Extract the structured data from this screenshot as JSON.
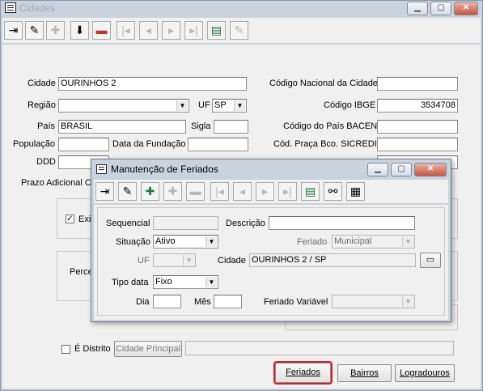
{
  "main_window": {
    "title": "Cidades",
    "fields": {
      "cidade_label": "Cidade",
      "cidade_value": "OURINHOS 2",
      "regiao_label": "Região",
      "regiao_value": "",
      "uf_label": "UF",
      "uf_value": "SP",
      "pais_label": "País",
      "pais_value": "BRASIL",
      "sigla_label": "Sigla",
      "sigla_value": "",
      "populacao_label": "População",
      "populacao_value": "",
      "data_fundacao_label": "Data da Fundação",
      "data_fundacao_value": "",
      "ddd_label": "DDD",
      "ddd_value": "",
      "prazo_label": "Prazo Adicional Co",
      "codigo_nacional_label": "Código Nacional da Cidade",
      "codigo_nacional_value": "",
      "codigo_ibge_label": "Código IBGE",
      "codigo_ibge_value": "3534708",
      "codigo_pais_bacen_label": "Código do País BACEN",
      "codigo_pais_bacen_value": "",
      "cod_praca_label": "Cód. Praça Bco. SICREDI",
      "cod_praca_value": ""
    },
    "partial": {
      "exi_label": "Exi",
      "perce_label": "Perce"
    },
    "distrito_label": "É Distrito",
    "cidade_principal_button": "Cidade Principal",
    "cidade_principal_value": "",
    "buttons": {
      "feriados": "Feriados",
      "bairros": "Bairros",
      "logradouros": "Logradouros"
    }
  },
  "modal": {
    "title": "Manutenção de Feriados",
    "sequencial_label": "Sequencial",
    "sequencial_value": "",
    "descricao_label": "Descrição",
    "descricao_value": "",
    "situacao_label": "Situação",
    "situacao_value": "Ativo",
    "feriado_label": "Feriado",
    "feriado_value": "Municipal",
    "uf_label": "UF",
    "uf_value": "",
    "cidade_label": "Cidade",
    "cidade_value": "OURINHOS 2 / SP",
    "tipo_data_label": "Tipo data",
    "tipo_data_value": "Fixo",
    "dia_label": "Dia",
    "dia_value": "",
    "mes_label": "Mês",
    "mes_value": "",
    "feriado_variavel_label": "Feriado Variável",
    "feriado_variavel_value": ""
  },
  "icons": {
    "exit": "exit-icon",
    "edit": "pencil-icon",
    "add": "add-record-icon",
    "save": "save-icon",
    "cancel": "cancel-icon",
    "first": "first-record-icon",
    "prev": "previous-record-icon",
    "next": "next-record-icon",
    "last": "last-record-icon",
    "grid": "grid-view-icon",
    "search": "binoculars-icon",
    "report": "report-icon"
  },
  "colors": {
    "frame": "#c9d3de",
    "client": "#f0f0f0",
    "close_button": "#c9553f",
    "focus_outline": "#d0202a"
  }
}
